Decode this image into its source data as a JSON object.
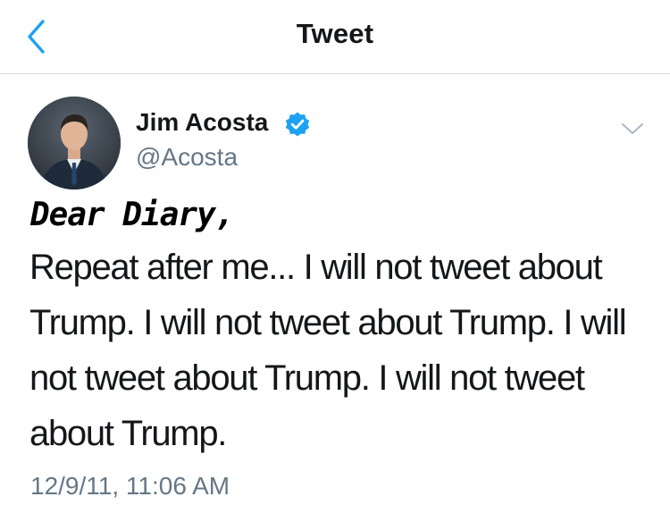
{
  "nav": {
    "title": "Tweet",
    "back_icon": "chevron-left-icon"
  },
  "author": {
    "name": "Jim Acosta",
    "handle": "@Acosta",
    "verified": true,
    "verified_icon": "verified-badge-icon"
  },
  "menu": {
    "icon": "chevron-down-icon"
  },
  "tweet": {
    "heading": "Dear Diary,",
    "body": "Repeat after me... I will not tweet about Trump. I will not tweet about Trump.  I will not tweet about Trump. I will not tweet about Trump.",
    "timestamp": "12/9/11, 11:06 AM"
  },
  "colors": {
    "accent": "#1da1f2",
    "text": "#14171a",
    "secondary": "#657786",
    "divider": "#d6d9db"
  }
}
